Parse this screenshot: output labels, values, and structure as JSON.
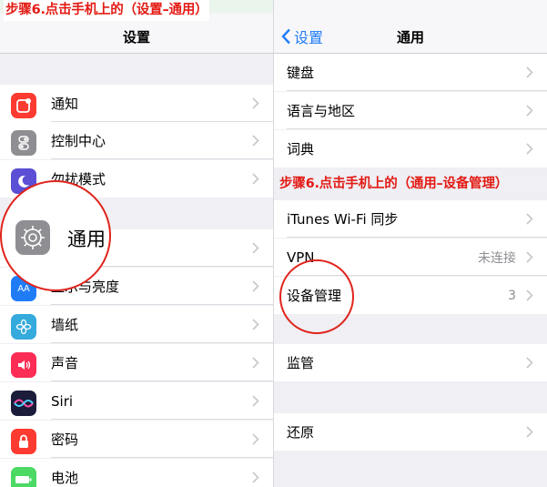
{
  "left": {
    "nav_title": "设置",
    "caption": "步骤6.点击手机上的（设置–通用）",
    "items": [
      {
        "label": "通知",
        "icon": "notifications-icon",
        "color": "#fd3b30"
      },
      {
        "label": "控制中心",
        "icon": "control-center-icon",
        "color": "#8e8e93"
      },
      {
        "label": "勿扰模式",
        "icon": "moon-icon",
        "color": "#5b4fd6"
      },
      {
        "label": "通用",
        "icon": "gear-icon",
        "color": "#8e8e93"
      },
      {
        "label": "显示与亮度",
        "icon": "display-icon",
        "color": "#1f7cf6"
      },
      {
        "label": "墙纸",
        "icon": "wallpaper-icon",
        "color": "#35aadc"
      },
      {
        "label": "声音",
        "icon": "sound-icon",
        "color": "#fd2d55"
      },
      {
        "label": "Siri",
        "icon": "siri-icon",
        "color": "#1b1b3a"
      },
      {
        "label": "密码",
        "icon": "lock-icon",
        "color": "#fd3b30"
      },
      {
        "label": "电池",
        "icon": "battery-icon",
        "color": "#4cd964"
      }
    ],
    "magnifier_label": "通用"
  },
  "right": {
    "back_label": "设置",
    "nav_title": "通用",
    "caption": "步骤6.点击手机上的（通用–设备管理）",
    "items": [
      {
        "label": "键盘"
      },
      {
        "label": "语言与地区"
      },
      {
        "label": "词典"
      },
      {
        "label": "iTunes Wi-Fi 同步"
      },
      {
        "label": "VPN",
        "value": "未连接"
      },
      {
        "label": "设备管理",
        "value": "3"
      },
      {
        "label": "监管"
      },
      {
        "label": "还原"
      }
    ]
  },
  "colors": {
    "accent": "#1f7cf6",
    "annotation": "#e31b14"
  }
}
